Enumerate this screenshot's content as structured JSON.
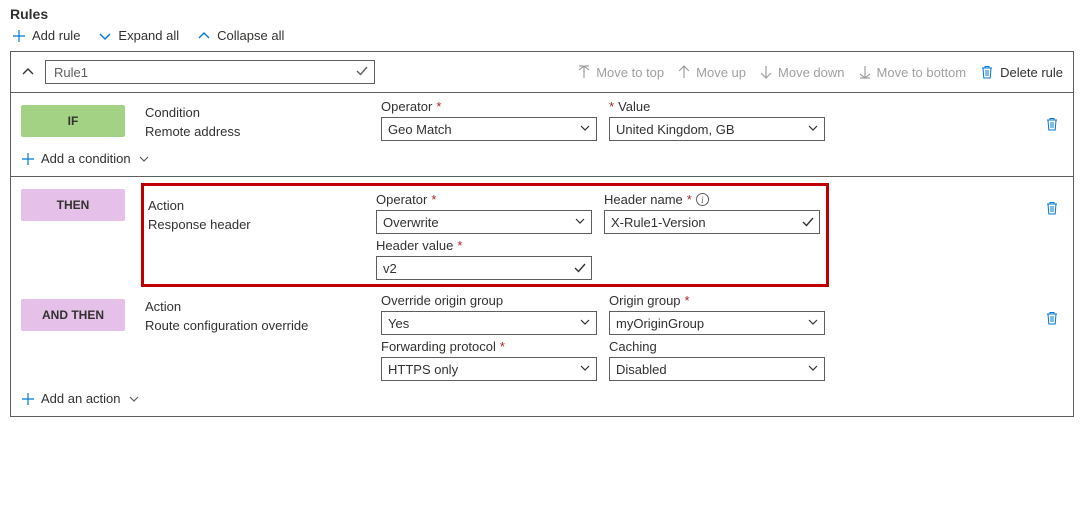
{
  "heading": "Rules",
  "toolbar": {
    "add": "Add rule",
    "expand": "Expand all",
    "collapse": "Collapse all"
  },
  "rule": {
    "name": "Rule1",
    "move_top": "Move to top",
    "move_up": "Move up",
    "move_down": "Move down",
    "move_bottom": "Move to bottom",
    "delete": "Delete rule"
  },
  "condition": {
    "title": "Condition",
    "name": "Remote address",
    "operator_label": "Operator",
    "operator": "Geo Match",
    "value_label": "Value",
    "value": "United Kingdom, GB",
    "add": "Add a condition"
  },
  "action1": {
    "title": "Action",
    "name": "Response header",
    "operator_label": "Operator",
    "operator": "Overwrite",
    "hname_label": "Header name",
    "hname": "X-Rule1-Version",
    "hvalue_label": "Header value",
    "hvalue": "v2"
  },
  "action2": {
    "title": "Action",
    "name": "Route configuration override",
    "override_label": "Override origin group",
    "override": "Yes",
    "group_label": "Origin group",
    "group": "myOriginGroup",
    "proto_label": "Forwarding protocol",
    "proto": "HTTPS only",
    "cache_label": "Caching",
    "cache": "Disabled",
    "add": "Add an action"
  },
  "badges": {
    "if": "IF",
    "then": "THEN",
    "andthen": "AND THEN"
  }
}
